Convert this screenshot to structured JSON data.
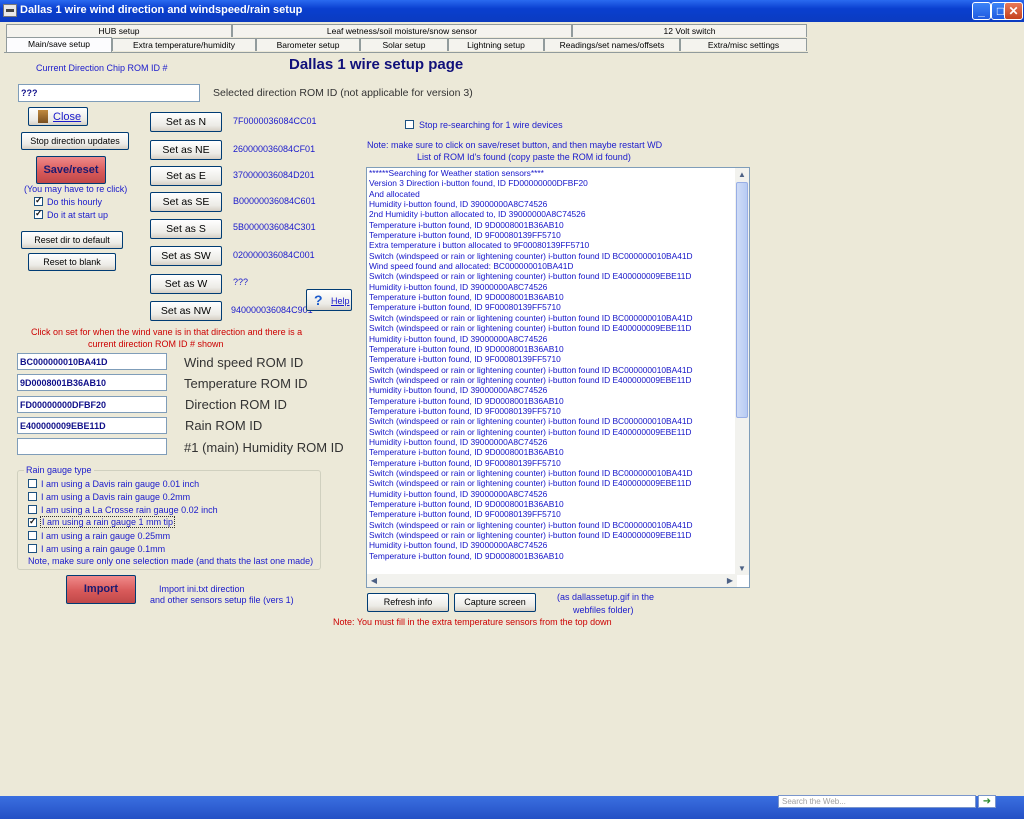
{
  "window": {
    "title": "Dallas 1 wire wind direction and windspeed/rain setup"
  },
  "tabs": {
    "row1": [
      "HUB setup",
      "Leaf wetness/soil moisture/snow sensor",
      "12 Volt switch"
    ],
    "row2": [
      "Main/save setup",
      "Extra temperature/humidity",
      "Barometer setup",
      "Solar setup",
      "Lightning setup",
      "Readings/set names/offsets",
      "Extra/misc settings"
    ]
  },
  "page": {
    "chip_label": "Current Direction Chip ROM ID #",
    "title": "Dallas 1 wire setup page",
    "direction_value": "???",
    "selected_label": "Selected direction ROM ID  (not applicable for version 3)"
  },
  "buttons": {
    "close": "Close",
    "stop_updates": "Stop direction updates",
    "save_reset": "Save/reset",
    "reset_default": "Reset dir to default",
    "reset_blank": "Reset to blank",
    "help": "Help",
    "import": "Import",
    "refresh": "Refresh info",
    "capture": "Capture screen"
  },
  "save_note": "(You may have to re click)",
  "checks": {
    "hourly": {
      "label": "Do this hourly",
      "checked": true
    },
    "startup": {
      "label": "Do it at start up",
      "checked": true
    },
    "stop_research": {
      "label": "Stop re-searching for 1 wire devices",
      "checked": false
    }
  },
  "directions": [
    {
      "label": "Set as  N",
      "rom": "7F0000036084CC01"
    },
    {
      "label": "Set as NE",
      "rom": "260000036084CF01"
    },
    {
      "label": "Set as E",
      "rom": "370000036084D201"
    },
    {
      "label": "Set as SE",
      "rom": "B00000036084C601"
    },
    {
      "label": "Set as S",
      "rom": "5B0000036084C301"
    },
    {
      "label": "Set as SW",
      "rom": "020000036084C001"
    },
    {
      "label": "Set as W",
      "rom": "???"
    },
    {
      "label": "Set as NW",
      "rom": "940000036084C901"
    }
  ],
  "click_note": {
    "line1": "Click on set for when the wind vane is in that direction and there is a",
    "line2": "current direction ROM ID #  shown"
  },
  "roms": [
    {
      "value": "BC000000010BA41D",
      "label": "Wind speed ROM ID"
    },
    {
      "value": "9D0008001B36AB10",
      "label": "Temperature ROM ID"
    },
    {
      "value": "FD00000000DFBF20",
      "label": "Direction ROM ID"
    },
    {
      "value": "E400000009EBE11D",
      "label": "Rain ROM ID"
    },
    {
      "value": "",
      "label": "#1 (main) Humidity ROM ID"
    }
  ],
  "rain": {
    "title": "Rain gauge type",
    "options": [
      {
        "label": "I am using a Davis rain gauge 0.01 inch",
        "checked": false
      },
      {
        "label": "I am using a Davis rain gauge 0.2mm",
        "checked": false
      },
      {
        "label": "I am using a La Crosse rain gauge 0.02 inch",
        "checked": false
      },
      {
        "label": "I am using a rain gauge 1 mm tip",
        "checked": true
      },
      {
        "label": "I am using a rain gauge 0.25mm",
        "checked": false
      },
      {
        "label": "I am using a rain gauge 0.1mm",
        "checked": false
      }
    ],
    "note": "Note, make sure only one selection made (and thats the last one made)"
  },
  "import_note": {
    "line1": "Import ini.txt direction",
    "line2": "and other sensors setup file (vers 1)"
  },
  "right_note": {
    "line1": "Note: make sure to click on save/reset button, and then maybe restart WD",
    "line2": "List of ROM Id's found (copy paste the ROM id found)"
  },
  "sensor_lines": [
    "******Searching for Weather station sensors****",
    "Version 3 Direction i-button found, ID FD00000000DFBF20",
    "And allocated",
    "Humidity i-button found, ID 39000000A8C74526",
    "2nd Humidity i-button allocated to, ID 39000000A8C74526",
    "Temperature i-button found, ID 9D0008001B36AB10",
    "Temperature i-button found, ID 9F00080139FF5710",
    "Extra temperature i button allocated to 9F00080139FF5710",
    "Switch (windspeed or rain or lightening counter) i-button found ID BC000000010BA41D",
    "Wind speed found and allocated: BC000000010BA41D",
    "Switch (windspeed or rain or lightening counter) i-button found ID E400000009EBE11D",
    "Humidity i-button found, ID 39000000A8C74526",
    "Temperature i-button found, ID 9D0008001B36AB10",
    "Temperature i-button found, ID 9F00080139FF5710",
    "Switch (windspeed or rain or lightening counter) i-button found ID BC000000010BA41D",
    "Switch (windspeed or rain or lightening counter) i-button found ID E400000009EBE11D",
    "Humidity i-button found, ID 39000000A8C74526",
    "Temperature i-button found, ID 9D0008001B36AB10",
    "Temperature i-button found, ID 9F00080139FF5710",
    "Switch (windspeed or rain or lightening counter) i-button found ID BC000000010BA41D",
    "Switch (windspeed or rain or lightening counter) i-button found ID E400000009EBE11D",
    "Humidity i-button found, ID 39000000A8C74526",
    "Temperature i-button found, ID 9D0008001B36AB10",
    "Temperature i-button found, ID 9F00080139FF5710",
    "Switch (windspeed or rain or lightening counter) i-button found ID BC000000010BA41D",
    "Switch (windspeed or rain or lightening counter) i-button found ID E400000009EBE11D",
    "Humidity i-button found, ID 39000000A8C74526",
    "Temperature i-button found, ID 9D0008001B36AB10",
    "Temperature i-button found, ID 9F00080139FF5710",
    "Switch (windspeed or rain or lightening counter) i-button found ID BC000000010BA41D",
    "Switch (windspeed or rain or lightening counter) i-button found ID E400000009EBE11D",
    "Humidity i-button found, ID 39000000A8C74526",
    "Temperature i-button found, ID 9D0008001B36AB10",
    "Temperature i-button found, ID 9F00080139FF5710",
    "Switch (windspeed or rain or lightening counter) i-button found ID BC000000010BA41D",
    "Switch (windspeed or rain or lightening counter) i-button found ID E400000009EBE11D",
    "Humidity i-button found, ID 39000000A8C74526",
    "Temperature i-button found, ID 9D0008001B36AB10"
  ],
  "capture_note": {
    "line1": "(as dallassetup.gif in the",
    "line2": "webfiles folder)"
  },
  "bottom_note": "Note: You must fill in the extra temperature sensors from the top down",
  "taskbar": {
    "search_placeholder": "Search the Web..."
  }
}
